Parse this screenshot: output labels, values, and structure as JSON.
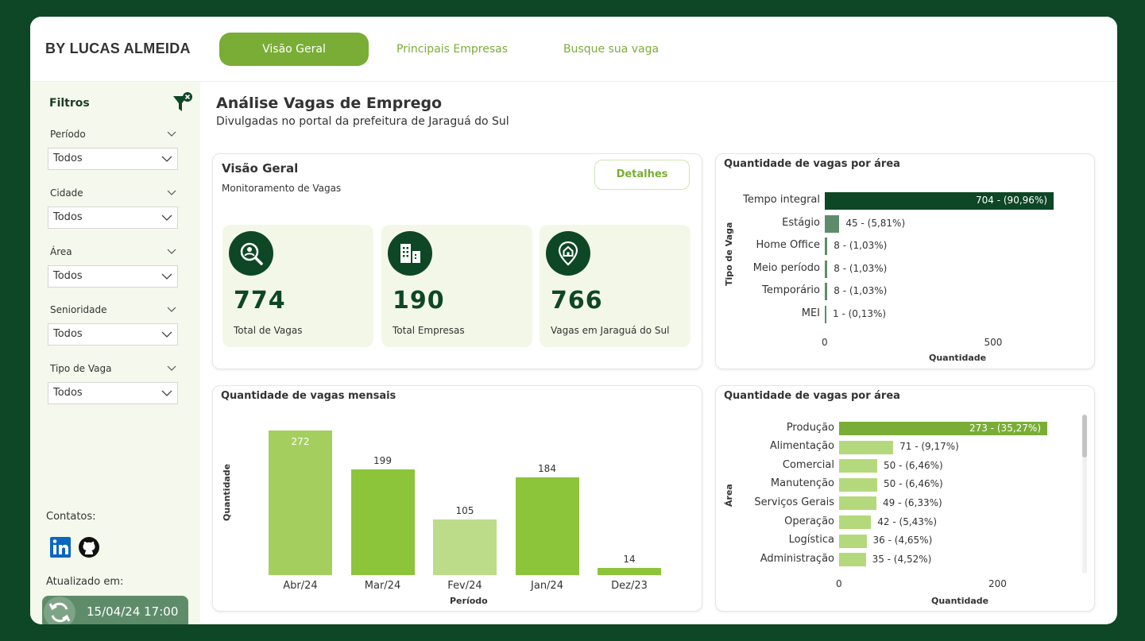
{
  "header": {
    "brand": "BY LUCAS ALMEIDA",
    "tabs": [
      "Visão Geral",
      "Principais Empresas",
      "Busque sua vaga"
    ],
    "active_tab": 0
  },
  "sidebar": {
    "title": "Filtros",
    "filters": [
      {
        "label": "Período",
        "value": "Todos"
      },
      {
        "label": "Cidade",
        "value": "Todos"
      },
      {
        "label": "Área",
        "value": "Todos"
      },
      {
        "label": "Senioridade",
        "value": "Todos"
      },
      {
        "label": "Tipo de Vaga",
        "value": "Todos"
      }
    ],
    "contacts_label": "Contatos:",
    "updated_label": "Atualizado em:",
    "updated_value": "15/04/24 17:00"
  },
  "page": {
    "title": "Análise Vagas de Emprego",
    "subtitle": "Divulgadas no portal da prefeitura de Jaraguá do Sul"
  },
  "overview": {
    "title": "Visão Geral",
    "subtitle": "Monitoramento de Vagas",
    "details_label": "Detalhes",
    "kpis": [
      {
        "value": "774",
        "label": "Total de Vagas",
        "icon": "search-person-icon"
      },
      {
        "value": "190",
        "label": "Total Empresas",
        "icon": "buildings-icon"
      },
      {
        "value": "766",
        "label": "Vagas em Jaraguá do Sul",
        "icon": "location-home-icon"
      }
    ]
  },
  "colors": {
    "dark_green": "#0e4726",
    "accent": "#79ad35",
    "light_green": "#a4cf5e",
    "pale_green": "#bcdc8a",
    "mid_green": "#8cc43a"
  },
  "chart_data": [
    {
      "type": "bar",
      "orientation": "horizontal",
      "title": "Quantidade de vagas por área",
      "ylabel": "Tipo de Vaga",
      "xlabel": "Quantidade",
      "xticks": [
        "0",
        "500"
      ],
      "xlim": [
        0,
        774
      ],
      "categories": [
        "Tempo integral",
        "Estágio",
        "Home Office",
        "Meio período",
        "Temporário",
        "MEI"
      ],
      "values": [
        704,
        45,
        8,
        8,
        8,
        1
      ],
      "labels": [
        "704 - (90,96%)",
        "45 - (5,81%)",
        "8 - (1,03%)",
        "8 - (1,03%)",
        "8 - (1,03%)",
        "1 - (0,13%)"
      ]
    },
    {
      "type": "bar",
      "orientation": "vertical",
      "title": "Quantidade de vagas mensais",
      "xlabel": "Período",
      "ylabel": "Quantidade",
      "ylim": [
        0,
        272
      ],
      "categories": [
        "Abr/24",
        "Mar/24",
        "Fev/24",
        "Jan/24",
        "Dez/23"
      ],
      "values": [
        272,
        199,
        105,
        184,
        14
      ],
      "labels": [
        "272",
        "199",
        "105",
        "184",
        "14"
      ]
    },
    {
      "type": "bar",
      "orientation": "horizontal",
      "title": "Quantidade de vagas por área",
      "ylabel": "Área",
      "xlabel": "Quantidade",
      "xticks": [
        "0",
        "200"
      ],
      "xlim": [
        0,
        295
      ],
      "categories": [
        "Produção",
        "Alimentação",
        "Comercial",
        "Manutenção",
        "Serviços Gerais",
        "Operação",
        "Logística",
        "Administração"
      ],
      "values": [
        273,
        71,
        50,
        50,
        49,
        42,
        36,
        35
      ],
      "labels": [
        "273 - (35,27%)",
        "71 - (9,17%)",
        "50 - (6,46%)",
        "50 - (6,46%)",
        "49 - (6,33%)",
        "42 - (5,43%)",
        "36 - (4,65%)",
        "35 - (4,52%)"
      ]
    }
  ]
}
